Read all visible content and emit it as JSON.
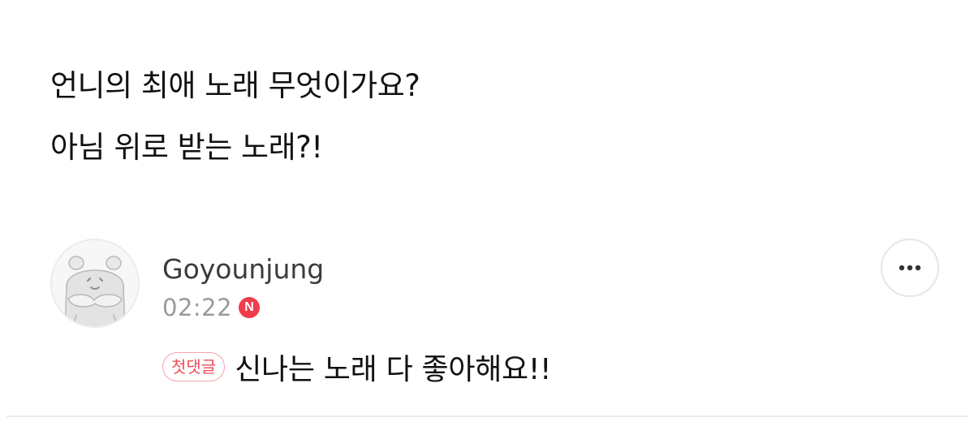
{
  "post": {
    "question_lines": [
      "언니의 최애 노래 무엇이가요?",
      "아님 위로 받는 노래?!"
    ]
  },
  "comment": {
    "author": "Goyounjung",
    "time": "02:22",
    "new_badge": "N",
    "first_comment_tag": "첫댓글",
    "text": "신나는 노래 다 좋아해요!!",
    "avatar_icon": "hamster-avatar-icon",
    "more_icon": "ellipsis-icon"
  },
  "colors": {
    "badge_red": "#f03c4b",
    "tag_red": "#ef4b57",
    "meta_gray": "#9a9a9a"
  }
}
